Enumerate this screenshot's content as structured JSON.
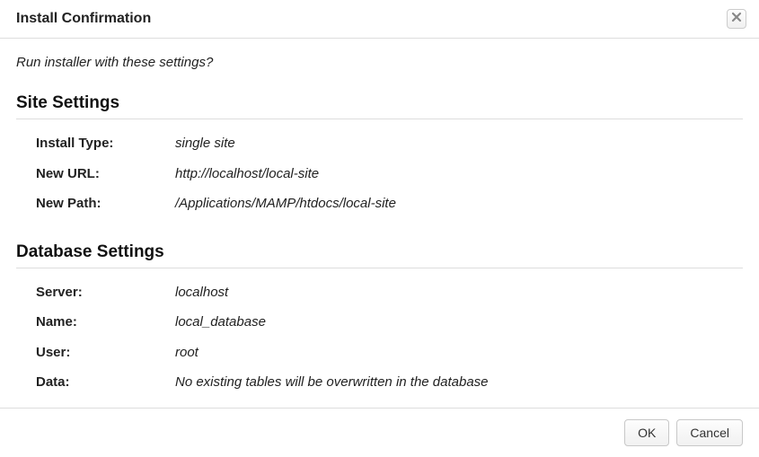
{
  "dialog": {
    "title": "Install Confirmation",
    "prompt": "Run installer with these settings?"
  },
  "sections": {
    "site": {
      "title": "Site Settings",
      "rows": {
        "installType": {
          "label": "Install Type:",
          "value": "single site"
        },
        "newUrl": {
          "label": "New URL:",
          "value": "http://localhost/local-site"
        },
        "newPath": {
          "label": "New Path:",
          "value": "/Applications/MAMP/htdocs/local-site"
        }
      }
    },
    "database": {
      "title": "Database Settings",
      "rows": {
        "server": {
          "label": "Server:",
          "value": "localhost"
        },
        "name": {
          "label": "Name:",
          "value": "local_database"
        },
        "user": {
          "label": "User:",
          "value": "root"
        },
        "data": {
          "label": "Data:",
          "value": "No existing tables will be overwritten in the database"
        }
      }
    }
  },
  "buttons": {
    "ok": "OK",
    "cancel": "Cancel"
  }
}
